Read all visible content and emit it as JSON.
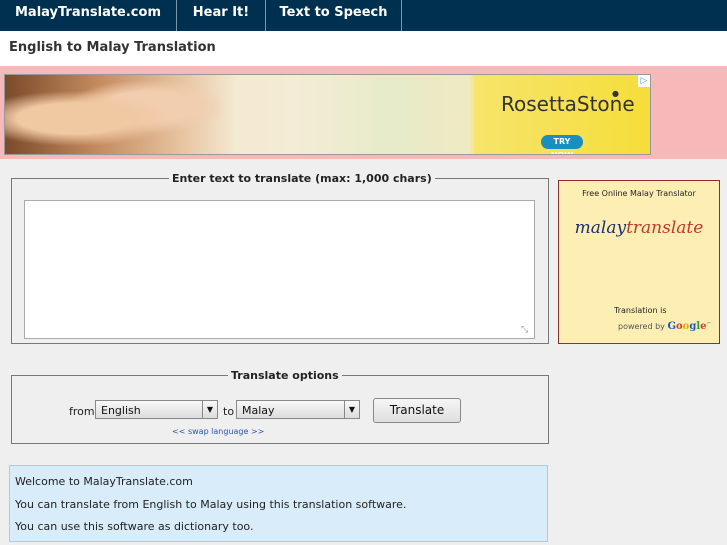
{
  "nav": {
    "items": [
      {
        "label": "MalayTranslate.com"
      },
      {
        "label": "Hear It!"
      },
      {
        "label": "Text to Speech"
      }
    ]
  },
  "header": {
    "title": "English to Malay Translation"
  },
  "ad": {
    "brand": "RosettaStone",
    "cta": "TRY NOW",
    "choices_icon": "adchoices-icon"
  },
  "translate_input": {
    "legend": "Enter text to translate (max: 1,000 chars)",
    "value": ""
  },
  "sidebar": {
    "title": "Free Online Malay Translator",
    "logo_part1": "malay",
    "logo_part2": "translate",
    "note": "Translation is",
    "powered": "powered by",
    "google": "Google",
    "tm": "™"
  },
  "options": {
    "legend": "Translate options",
    "from_label": "from",
    "from_value": "English",
    "to_label": "to",
    "to_value": "Malay",
    "translate_button": "Translate",
    "swap_link": "<< swap language >>"
  },
  "info": {
    "lines": [
      "Welcome to MalayTranslate.com",
      "You can translate from English to Malay using this translation software.",
      "You can use this software as dictionary too."
    ]
  }
}
